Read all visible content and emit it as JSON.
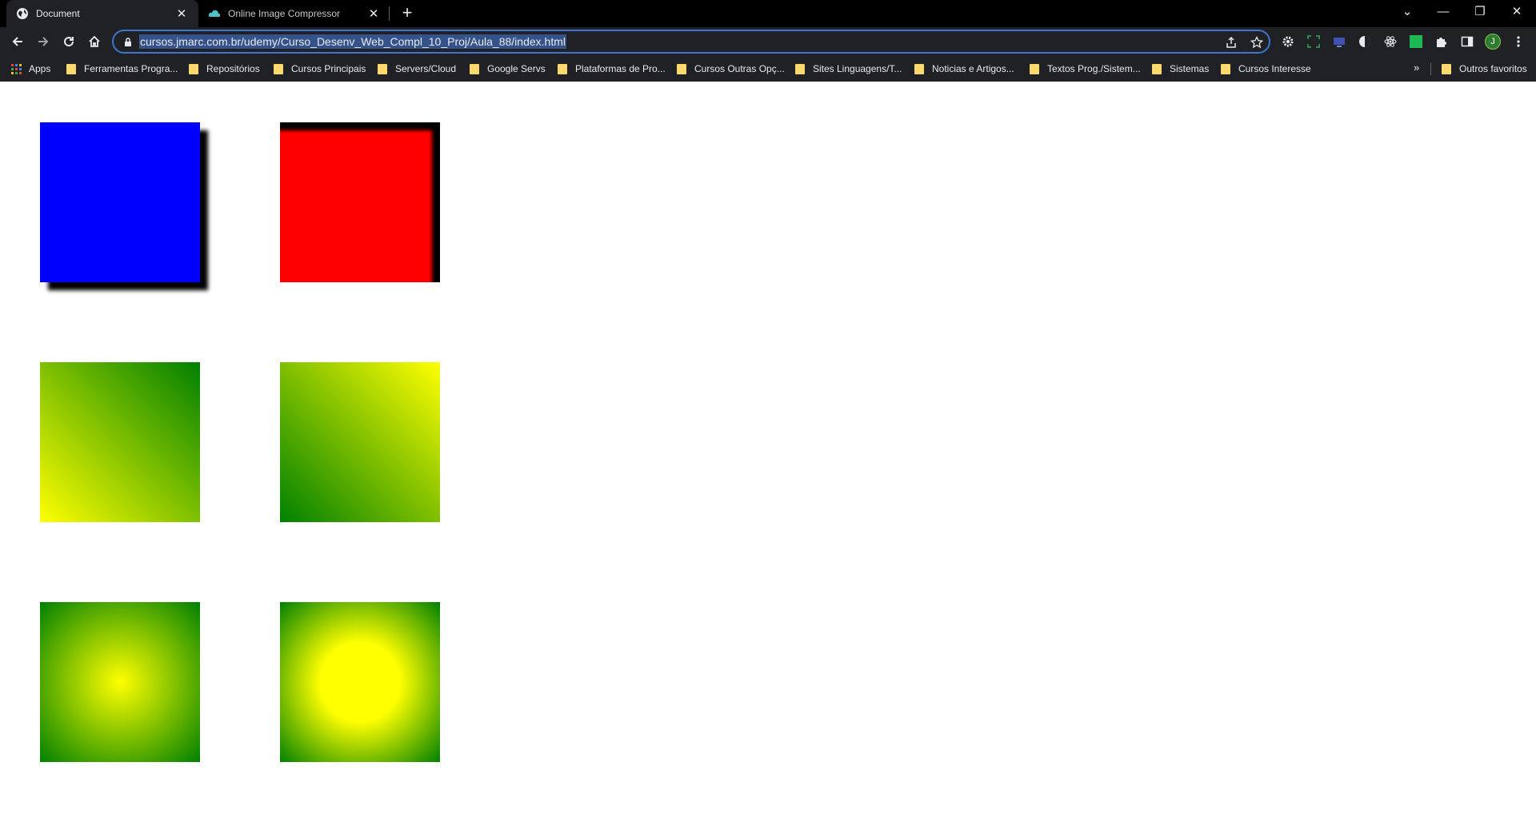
{
  "browser": {
    "tabs": [
      {
        "title": "Document",
        "active": true,
        "icon": "globe-icon"
      },
      {
        "title": "Online Image Compressor",
        "active": false,
        "icon": "cloud-icon"
      }
    ],
    "new_tab_label": "+",
    "window_controls": {
      "tab_search": "⌄",
      "minimize": "—",
      "restore": "❐",
      "close": "✕"
    },
    "url": "cursos.jmarc.com.br/udemy/Curso_Desenv_Web_Compl_10_Proj/Aula_88/index.html",
    "profile_initial": "J",
    "accent": "#3e75d1"
  },
  "bookmarks": {
    "apps_label": "Apps",
    "items": [
      "Ferramentas Progra...",
      "Repositórios",
      "Cursos Principais",
      "Servers/Cloud",
      "Google Servs",
      "Plataformas de Pro...",
      "Cursos Outras Opç...",
      "Sites Linguagens/T...",
      "Noticias e Artigos...",
      "Textos Prog./Sistem...",
      "Sistemas",
      "Cursos Interesse"
    ],
    "overflow_label": "»",
    "other_label": "Outros favoritos"
  },
  "page": {
    "boxes": [
      {
        "id": "blue-box-drop-shadow",
        "color": "#0000ff",
        "effect": "box-shadow"
      },
      {
        "id": "red-box-inset-shadow",
        "color": "#ff0000",
        "effect": "inset box-shadow"
      },
      {
        "id": "linear-gradient-yellow-green",
        "colors": [
          "#ffff00",
          "#008000"
        ],
        "effect": "linear-gradient"
      },
      {
        "id": "linear-gradient-green-yellow",
        "colors": [
          "#008000",
          "#ffff00"
        ],
        "effect": "linear-gradient"
      },
      {
        "id": "radial-gradient-small-center",
        "colors": [
          "#ffff00",
          "#008000"
        ],
        "effect": "radial-gradient"
      },
      {
        "id": "radial-gradient-large-center",
        "colors": [
          "#ffff00",
          "#008000"
        ],
        "effect": "radial-gradient"
      }
    ]
  }
}
